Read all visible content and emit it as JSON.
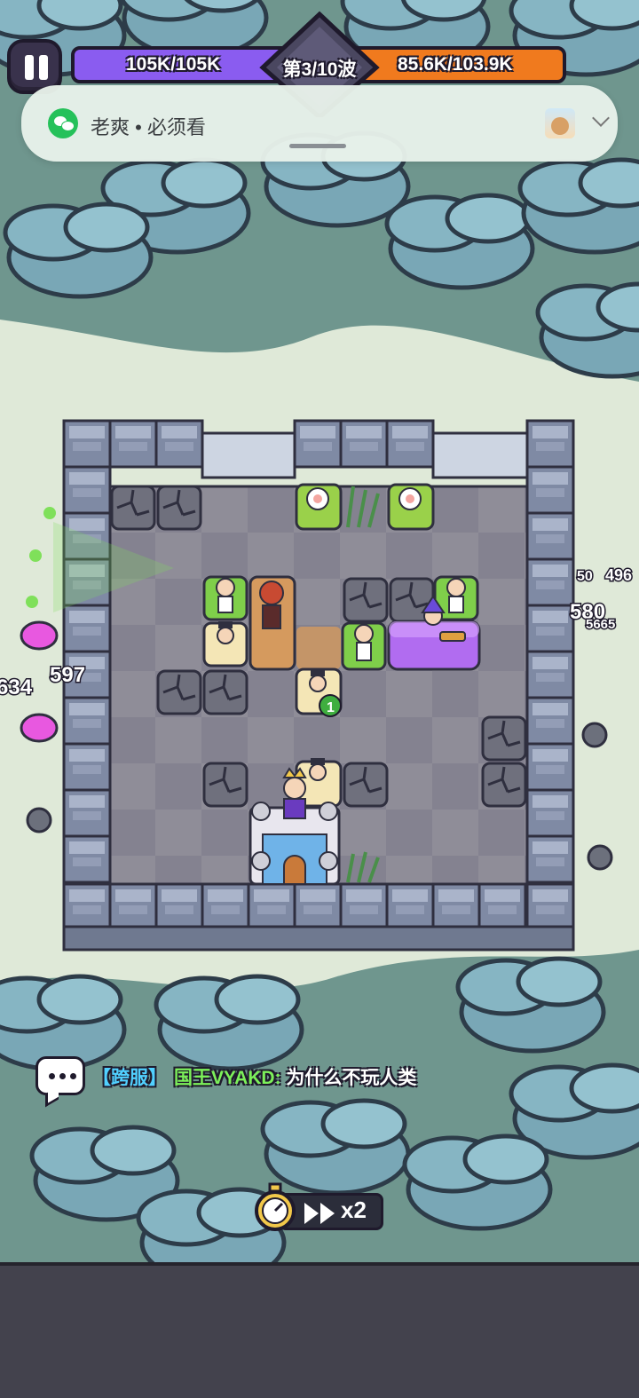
{
  "hud": {
    "player_hp": "105K/105K",
    "wave": "第3/10波",
    "enemy_hp": "85.6K/103.9K"
  },
  "notification": {
    "app_icon": "wechat-icon",
    "message": "老爽 • 必须看"
  },
  "damage_numbers": [
    "597",
    "634",
    "580",
    "5665",
    "496",
    "50"
  ],
  "tower_badge": "1",
  "chat": {
    "tag": "【跨服】",
    "sender": "国王VYAKD:",
    "text": "为什么不玩人类"
  },
  "speed_button": {
    "label": "x2"
  },
  "colors": {
    "player_bar": "#8a5cf0",
    "enemy_bar": "#f07a1e",
    "chat_tag": "#51d0ff",
    "chat_sender": "#7cf05a"
  }
}
